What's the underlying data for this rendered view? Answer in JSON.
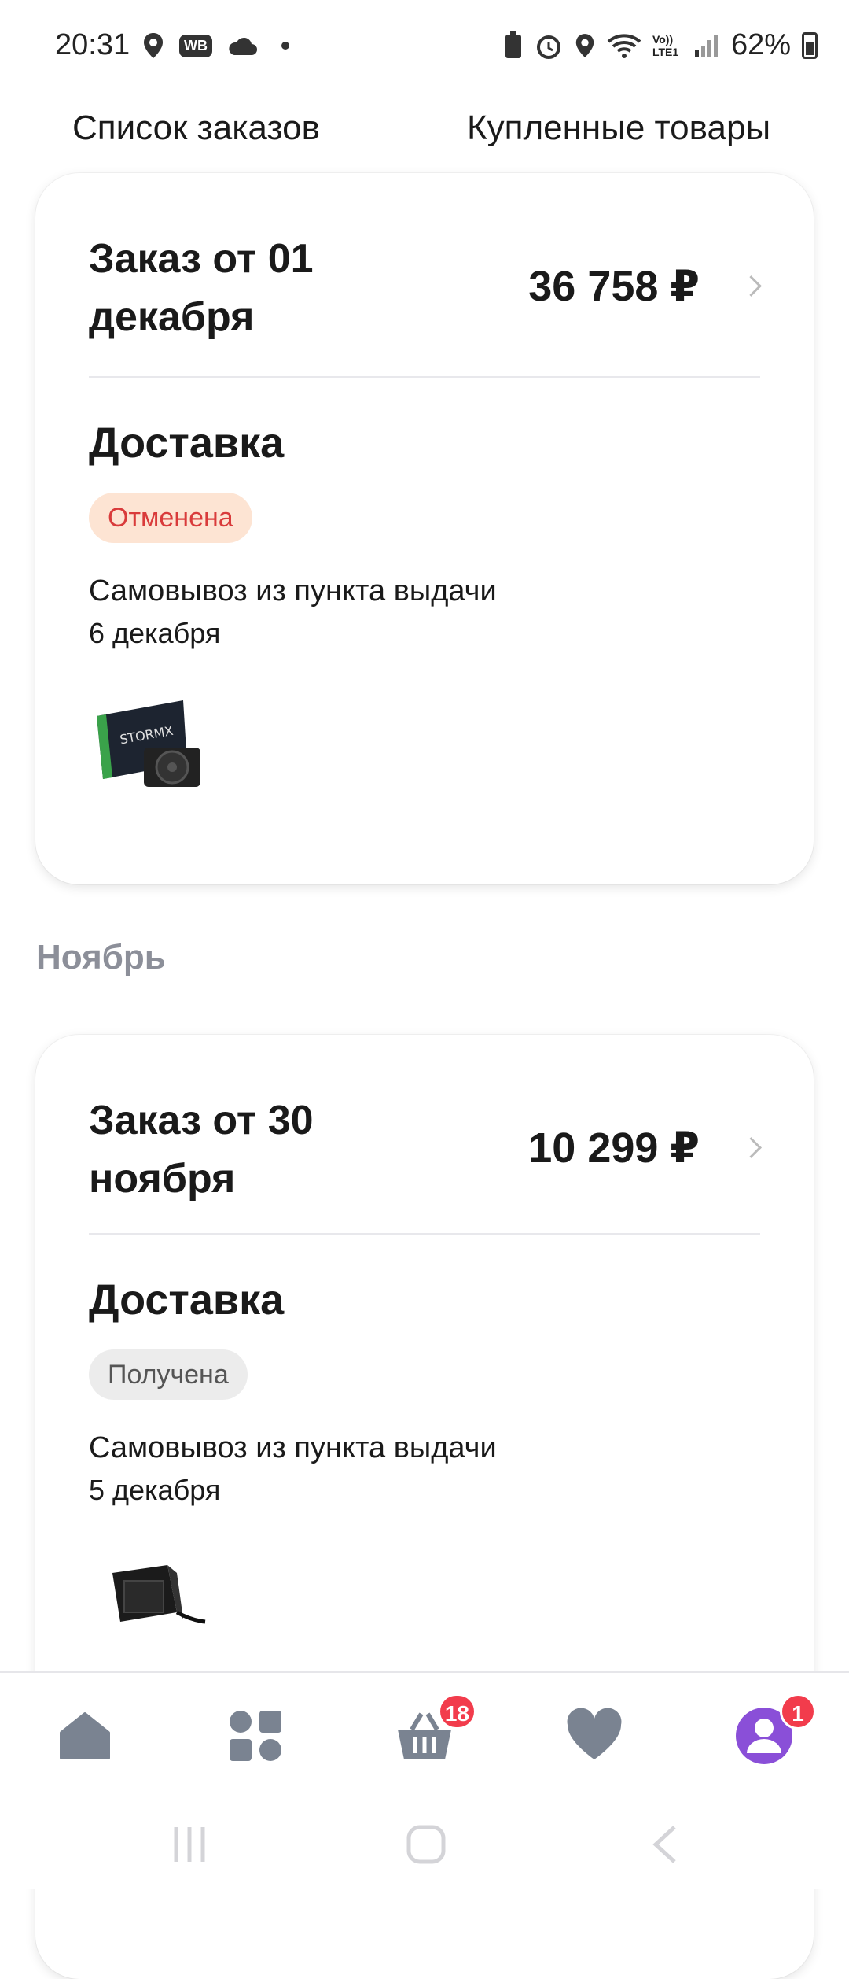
{
  "status_bar": {
    "time": "20:31",
    "wb_label": "WB",
    "battery": "62%",
    "network": "Vo)) LTE1"
  },
  "tabs": {
    "orders": "Список заказов",
    "purchased": "Купленные товары"
  },
  "orders": [
    {
      "title": "Заказ от 01 декабря",
      "price": "36 758 ₽",
      "section": "Доставка",
      "status": "Отменена",
      "delivery_type": "Самовывоз из пункта выдачи",
      "delivery_date": "6 декабря",
      "item_icon": "graphics-card-image"
    },
    {
      "title": "Заказ от 30 ноября",
      "price": "10 299 ₽",
      "section": "Доставка",
      "status": "Получена",
      "delivery_type": "Самовывоз из пункта выдачи",
      "delivery_date": "5 декабря",
      "item_icon": "power-supply-image"
    }
  ],
  "month_label": "Ноябрь",
  "bottom_nav": {
    "items": [
      {
        "icon": "home-icon"
      },
      {
        "icon": "catalog-icon"
      },
      {
        "icon": "cart-icon",
        "badge": "18"
      },
      {
        "icon": "heart-icon"
      },
      {
        "icon": "profile-icon",
        "badge": "1"
      }
    ]
  },
  "colors": {
    "accent": "#7b4fd6",
    "badge_red": "#f23c4c",
    "cancel_bg": "#fde4d3",
    "cancel_text": "#d93b3b",
    "received_bg": "#ececec",
    "nav_icon": "#7a8391"
  }
}
